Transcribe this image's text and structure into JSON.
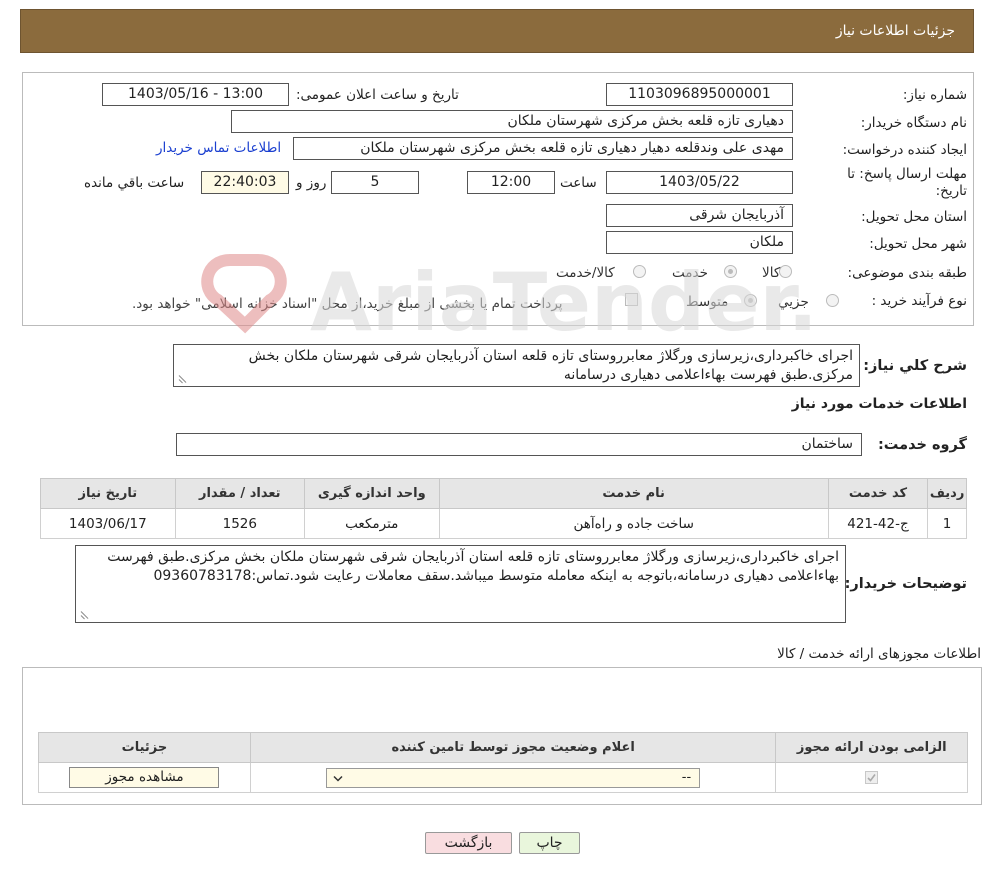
{
  "header": {
    "title": "جزئیات اطلاعات نیاز"
  },
  "labels": {
    "need_number": "شماره نیاز:",
    "announce_datetime": "تاریخ و ساعت اعلان عمومی:",
    "buyer_org": "نام دستگاه خریدار:",
    "creator": "ایجاد کننده درخواست:",
    "deadline_line1": "مهلت ارسال پاسخ: تا",
    "deadline_line2": "تاریخ:",
    "time_word": "ساعت",
    "day_and": "روز و",
    "remaining": "ساعت باقي مانده",
    "province": "استان محل تحویل:",
    "city": "شهر محل تحویل:",
    "category": "طبقه بندی موضوعی:",
    "purchase_type": "نوع فرآیند خرید :",
    "general_desc": "شرح کلي نياز:",
    "service_group": "گروه خدمت:",
    "buyer_notes": "توضیحات خریدار:"
  },
  "fields": {
    "need_number": "1103096895000001",
    "announce_datetime": "1403/05/16 - 13:00",
    "buyer_org": "دهیاری تازه قلعه بخش مرکزی شهرستان ملکان",
    "creator": "مهدی علی وندقلعه دهیار دهیاری تازه قلعه بخش مرکزی شهرستان ملکان",
    "contact_link": "اطلاعات تماس خریدار",
    "deadline_date": "1403/05/22",
    "deadline_time": "12:00",
    "days": "5",
    "remaining_time": "22:40:03",
    "province": "آذربایجان شرقی",
    "city": "ملکان",
    "service_group": "ساختمان"
  },
  "category_options": [
    {
      "label": "کالا",
      "selected": false
    },
    {
      "label": "خدمت",
      "selected": true
    },
    {
      "label": "کالا/خدمت",
      "selected": false
    }
  ],
  "purchase_options": [
    {
      "label": "جزیي",
      "selected": false
    },
    {
      "label": "متوسط",
      "selected": true
    }
  ],
  "purchase_note": "پرداخت تمام یا بخشی از مبلغ خرید،از محل \"اسناد خزانه اسلامی\" خواهد بود.",
  "general_desc": "اجرای خاکبرداری،زیرسازی ورگلاژ معابرروستای تازه قلعه استان آذربایجان شرقی شهرستان ملکان بخش مرکزی.طبق فهرست بهاءاعلامی دهیاری درسامانه",
  "services_title": "اطلاعات خدمات مورد نیاز",
  "services_table": {
    "headers": [
      "ردیف",
      "کد خدمت",
      "نام خدمت",
      "واحد اندازه گیری",
      "تعداد / مقدار",
      "تاریخ نیاز"
    ],
    "rows": [
      [
        "1",
        "ج-42-421",
        "ساخت جاده و راه‌آهن",
        "مترمکعب",
        "1526",
        "1403/06/17"
      ]
    ]
  },
  "buyer_notes": "اجرای خاکبرداری،زیرسازی ورگلاژ معابرروستای تازه قلعه استان آذربایجان شرقی شهرستان ملکان بخش مرکزی.طبق فهرست بهاءاعلامی دهیاری درسامانه،باتوجه به اینکه معامله متوسط میباشد.سقف معاملات رعایت شود.تماس:09360783178",
  "permits": {
    "title": "اطلاعات مجوزهای ارائه خدمت / کالا",
    "headers": [
      "الزامی بودن ارائه مجوز",
      "اعلام وضعیت مجوز توسط تامین کننده",
      "جزئیات"
    ],
    "select_value": "--",
    "view_button": "مشاهده مجوز"
  },
  "buttons": {
    "print": "چاپ",
    "back": "بازگشت"
  },
  "watermark": "AriaTender.neT",
  "colors": {
    "header_bg": "#8b6b3d",
    "link": "#1a3fd0",
    "back_btn_bg": "#f9dde0",
    "print_btn_bg": "#e9f6dc"
  }
}
